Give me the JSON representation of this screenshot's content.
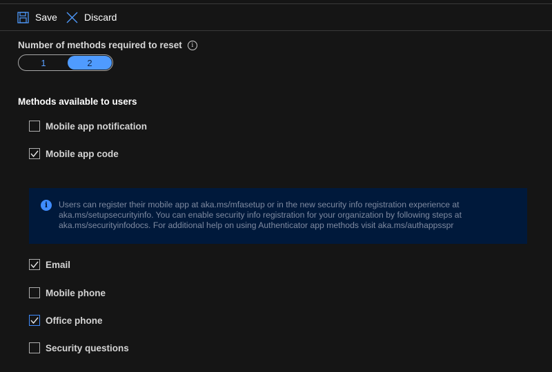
{
  "toolbar": {
    "save_label": "Save",
    "discard_label": "Discard"
  },
  "reset": {
    "label": "Number of methods required to reset",
    "options": [
      "1",
      "2"
    ],
    "selected": "2"
  },
  "methods": {
    "title": "Methods available to users",
    "items": [
      {
        "label": "Mobile app notification",
        "checked": false
      },
      {
        "label": "Mobile app code",
        "checked": true
      },
      {
        "label": "Email",
        "checked": true
      },
      {
        "label": "Mobile phone",
        "checked": false
      },
      {
        "label": "Office phone",
        "checked": true
      },
      {
        "label": "Security questions",
        "checked": false
      }
    ]
  },
  "info": {
    "icon": "info-icon",
    "text": "Users can register their mobile app at aka.ms/mfasetup or in the new security info registration experience at aka.ms/setupsecurityinfo. You can enable security info registration for your organization by following steps at aka.ms/securityinfodocs. For additional help on using Authenticator app methods visit aka.ms/authappsspr"
  },
  "colors": {
    "background": "#151515",
    "accent": "#4f9bff",
    "info_background": "#00193b"
  }
}
